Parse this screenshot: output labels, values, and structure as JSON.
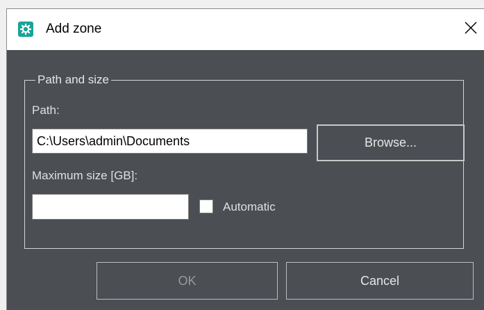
{
  "window": {
    "title": "Add zone",
    "app_icon": "gear-icon",
    "close_icon": "close-icon"
  },
  "group": {
    "legend": "Path and size",
    "path_label": "Path:",
    "path_value": "C:\\Users\\admin\\Documents",
    "browse_label": "Browse...",
    "max_size_label": "Maximum size [GB]:",
    "max_size_value": "",
    "automatic_label": "Automatic",
    "automatic_checked": false
  },
  "footer": {
    "ok_label": "OK",
    "cancel_label": "Cancel"
  },
  "colors": {
    "dialog_background": "#4b4e53",
    "icon_accent": "#1aa39a"
  }
}
